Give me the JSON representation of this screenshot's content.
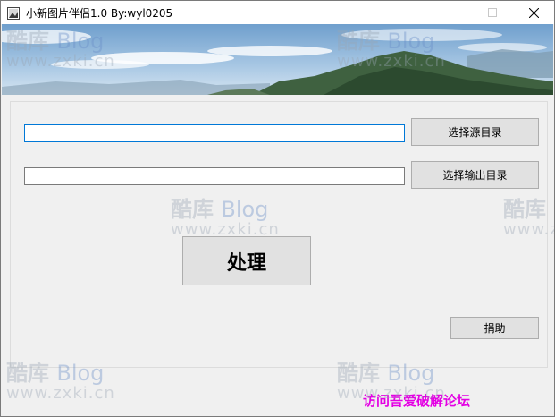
{
  "window": {
    "title": "小新图片伴侣1.0 By:wyl0205"
  },
  "form": {
    "source_dir_value": "",
    "output_dir_value": "",
    "select_source_label": "选择源目录",
    "select_output_label": "选择输出目录",
    "process_label": "处理",
    "donate_label": "捐助"
  },
  "footer": {
    "link_text": "访问吾爱破解论坛"
  },
  "watermark": {
    "brand_cn": "酷库",
    "brand_en": "Blog",
    "url": "www.zxki.cn"
  },
  "colors": {
    "link": "#e400e4",
    "focus_border": "#0078d7"
  }
}
